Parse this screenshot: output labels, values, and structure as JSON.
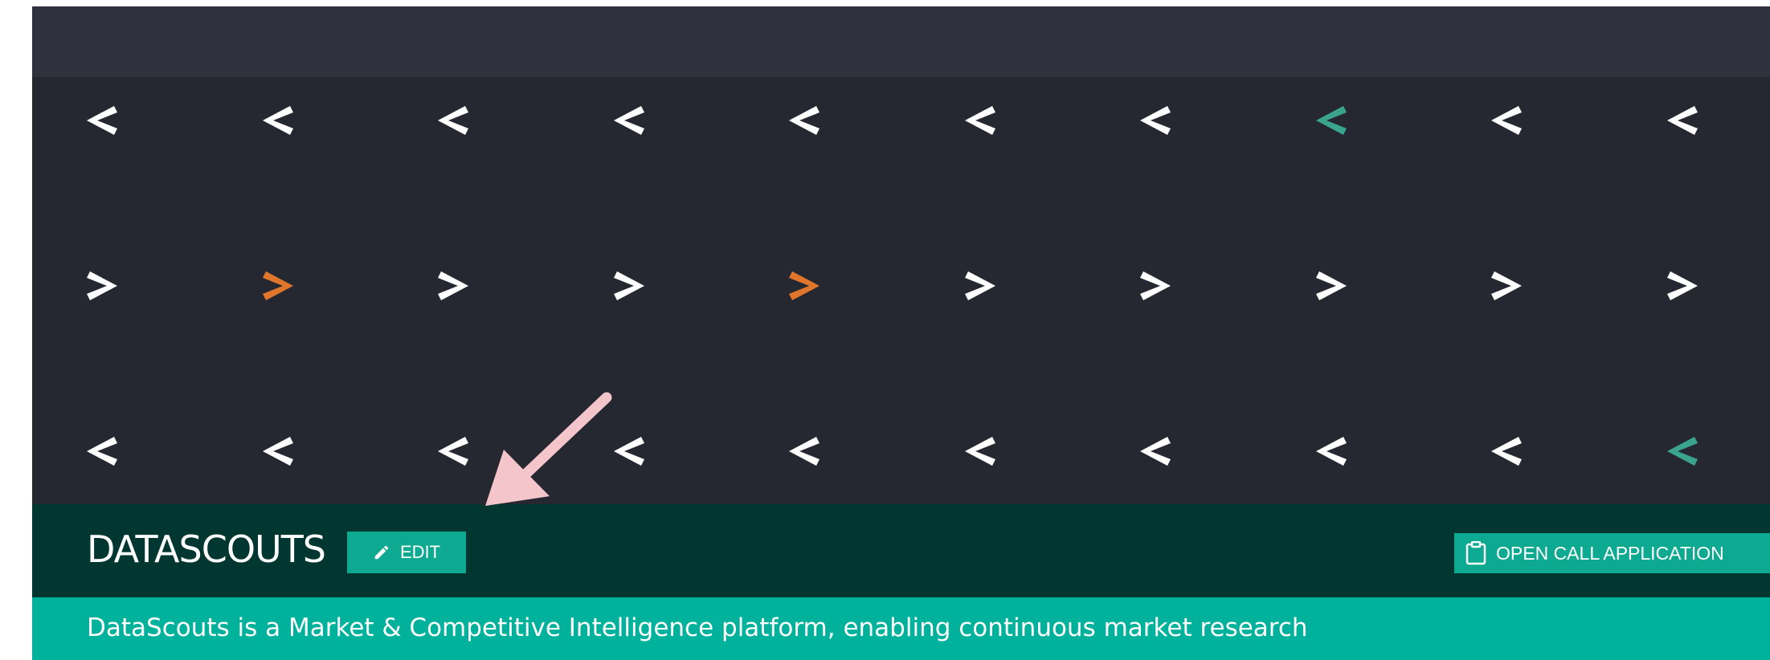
{
  "hero": {
    "pattern": [
      [
        "left",
        "left",
        "left",
        "left",
        "left",
        "left",
        "left",
        "left",
        "left",
        "left"
      ],
      [
        "right",
        "right",
        "right",
        "right",
        "right",
        "right",
        "right",
        "right",
        "right",
        "right"
      ],
      [
        "left",
        "left",
        "left",
        "left",
        "left",
        "left",
        "left",
        "left",
        "left",
        "left"
      ]
    ],
    "highlights": [
      {
        "row": 0,
        "col": 7,
        "color": "#3aa58c"
      },
      {
        "row": 1,
        "col": 1,
        "color": "#e0762b"
      },
      {
        "row": 1,
        "col": 4,
        "color": "#e0762b"
      },
      {
        "row": 2,
        "col": 9,
        "color": "#3aa58c"
      }
    ],
    "default_color": "#ffffff"
  },
  "header": {
    "company_name": "DATASCOUTS",
    "edit_label": "EDIT",
    "open_call_label": "OPEN CALL APPLICATION"
  },
  "tagline": "DataScouts is a Market & Competitive Intelligence platform, enabling continuous market research",
  "icons": {
    "edit": "pencil-icon",
    "open_call": "clipboard-icon"
  },
  "colors": {
    "top_bar": "#2f313c",
    "hero_background": "#252830",
    "title_bar": "#023731",
    "accent": "#0daa91",
    "tagline_bar": "#00b19b",
    "annotation_arrow": "#f4c6cc"
  }
}
